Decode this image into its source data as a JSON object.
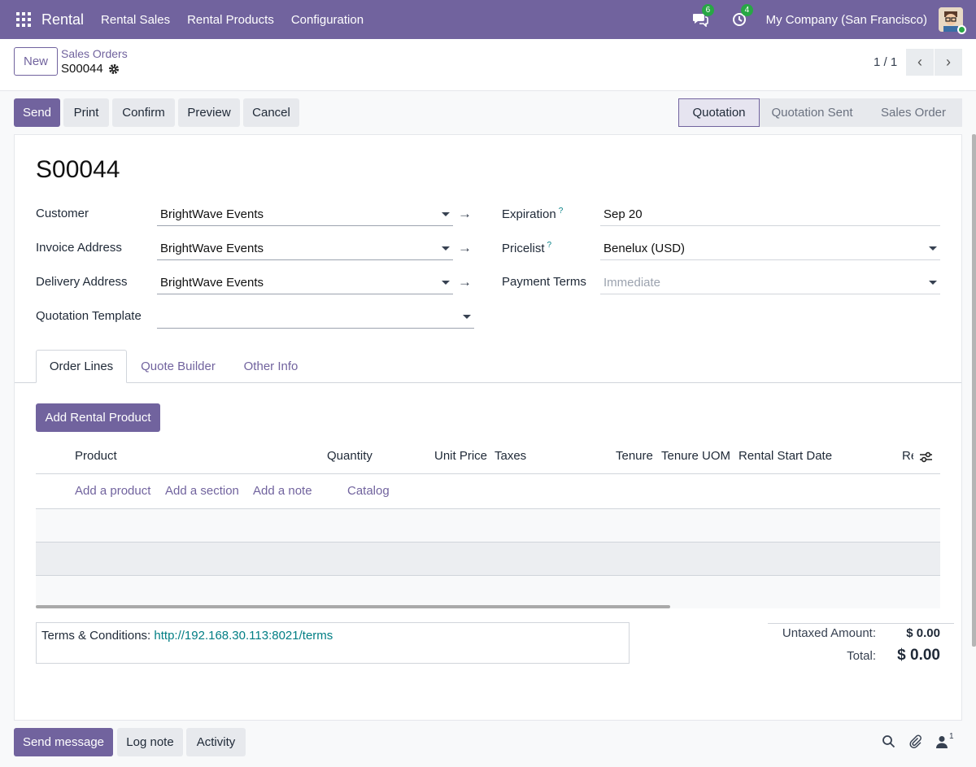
{
  "navbar": {
    "app_name": "Rental",
    "menu": [
      "Rental Sales",
      "Rental Products",
      "Configuration"
    ],
    "messages_count": "6",
    "activities_count": "4",
    "company": "My Company (San Francisco)"
  },
  "control_panel": {
    "new_label": "New",
    "breadcrumb_parent": "Sales Orders",
    "breadcrumb_current": "S00044",
    "pager": "1 / 1"
  },
  "actions": {
    "send": "Send",
    "print": "Print",
    "confirm": "Confirm",
    "preview": "Preview",
    "cancel": "Cancel"
  },
  "status_stages": [
    "Quotation",
    "Quotation Sent",
    "Sales Order"
  ],
  "form": {
    "title": "S00044",
    "customer_label": "Customer",
    "customer": "BrightWave Events",
    "invoice_address_label": "Invoice Address",
    "invoice_address": "BrightWave Events",
    "delivery_address_label": "Delivery Address",
    "delivery_address": "BrightWave Events",
    "quotation_template_label": "Quotation Template",
    "quotation_template": "",
    "expiration_label": "Expiration",
    "expiration": "Sep 20",
    "pricelist_label": "Pricelist",
    "pricelist": "Benelux (USD)",
    "payment_terms_label": "Payment Terms",
    "payment_terms_placeholder": "Immediate",
    "help_mark": "?"
  },
  "tabs": [
    "Order Lines",
    "Quote Builder",
    "Other Info"
  ],
  "order_lines": {
    "add_rental_label": "Add Rental Product",
    "columns": [
      "Product",
      "Quantity",
      "Unit Price",
      "Taxes",
      "Tenure",
      "Tenure UOM",
      "Rental Start Date",
      "Re"
    ],
    "add_links": [
      "Add a product",
      "Add a section",
      "Add a note",
      "Catalog"
    ]
  },
  "terms": {
    "label": "Terms & Conditions:",
    "link": "http://192.168.30.113:8021/terms"
  },
  "totals": {
    "untaxed_label": "Untaxed Amount:",
    "untaxed_value": "$ 0.00",
    "total_label": "Total:",
    "total_value": "$ 0.00"
  },
  "chatter": {
    "send_message": "Send message",
    "log_note": "Log note",
    "activity": "Activity",
    "followers_count": "1"
  },
  "colors": {
    "brand": "#71639e",
    "link": "#017e84",
    "badge": "#28a745"
  }
}
